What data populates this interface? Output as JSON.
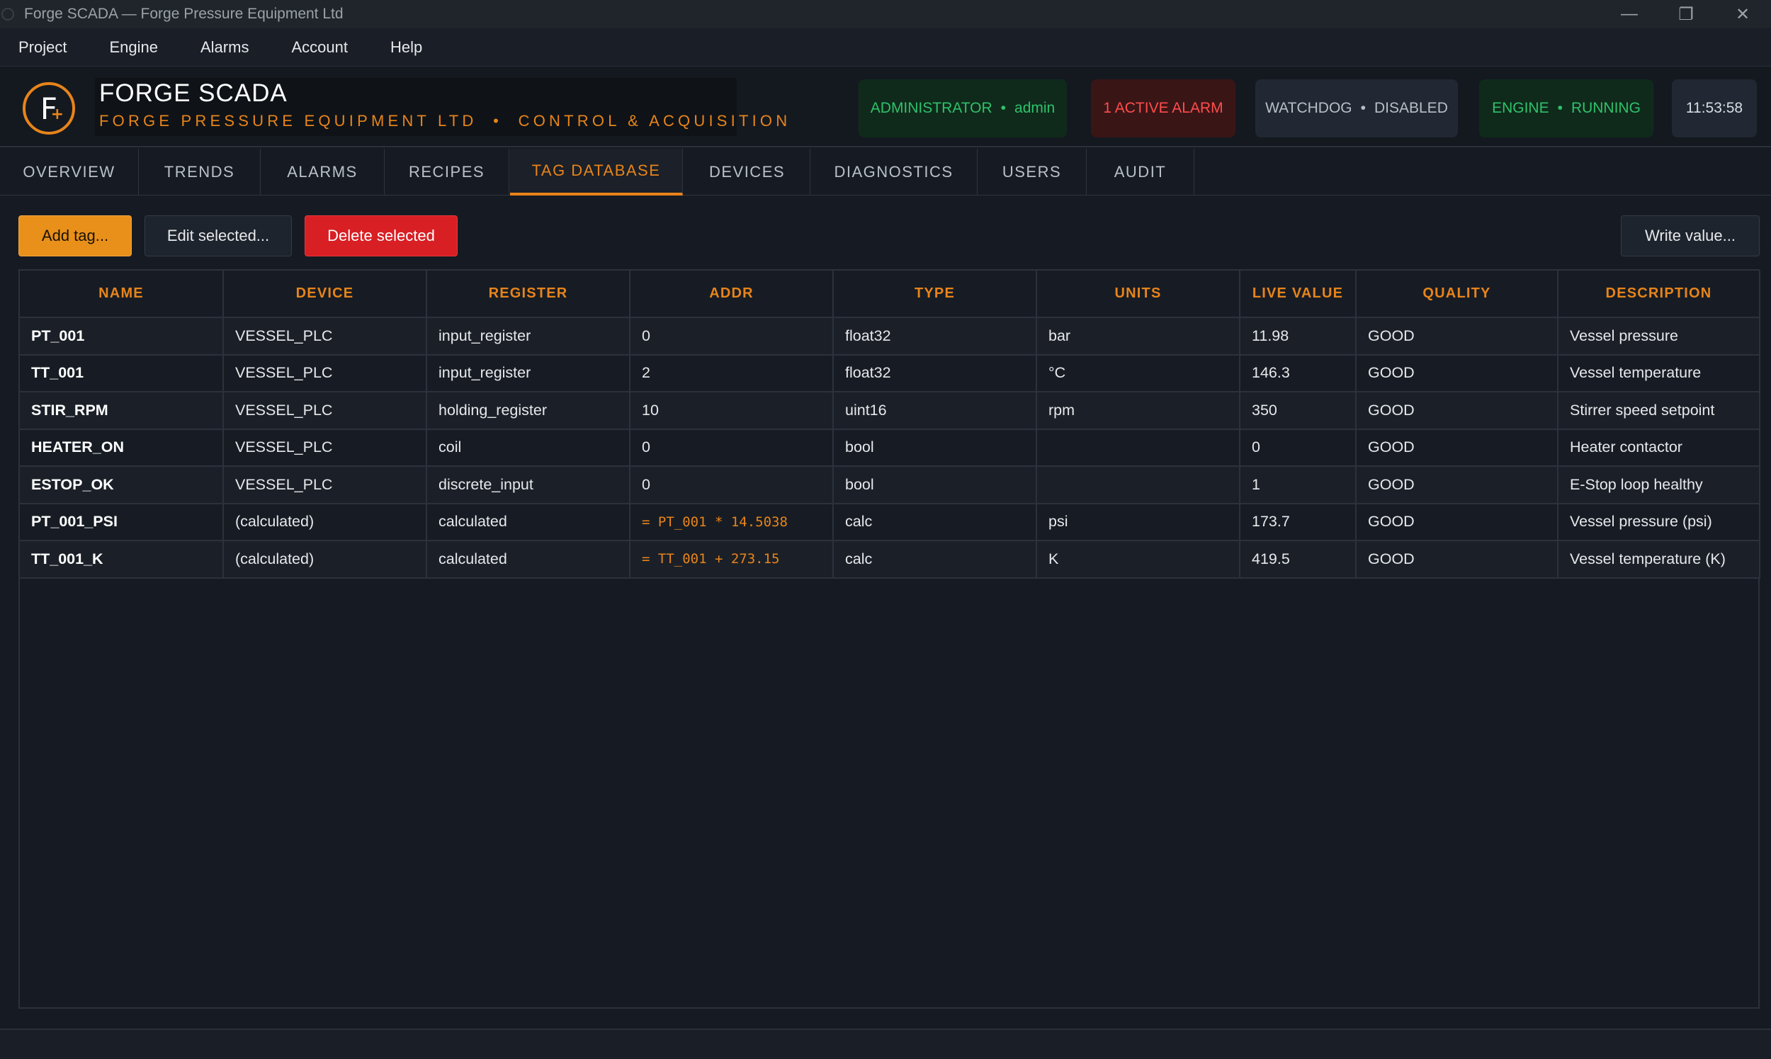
{
  "window": {
    "title": "Forge SCADA — Forge Pressure Equipment Ltd",
    "minimize_glyph": "—",
    "restore_glyph": "❐",
    "close_glyph": "✕"
  },
  "menu": {
    "items": [
      "Project",
      "Engine",
      "Alarms",
      "Account",
      "Help"
    ]
  },
  "header": {
    "logo_letter": "F",
    "logo_plus": "+",
    "title": "FORGE SCADA",
    "subtitle": "FORGE PRESSURE EQUIPMENT LTD  •  CONTROL & ACQUISITION",
    "role_label": "ADMINISTRATOR",
    "user": "admin",
    "dot": "•",
    "alarm_text": "1 ACTIVE ALARM",
    "watchdog_label": "WATCHDOG",
    "watchdog_state": "DISABLED",
    "engine_label": "ENGINE",
    "engine_state": "RUNNING",
    "clock": "11:53:58"
  },
  "tabs": [
    "OVERVIEW",
    "TRENDS",
    "ALARMS",
    "RECIPES",
    "TAG DATABASE",
    "DEVICES",
    "DIAGNOSTICS",
    "USERS",
    "AUDIT"
  ],
  "active_tab": "TAG DATABASE",
  "toolbar": {
    "add_label": "Add tag...",
    "edit_label": "Edit selected...",
    "delete_label": "Delete selected",
    "write_label": "Write value..."
  },
  "table": {
    "columns": [
      "NAME",
      "DEVICE",
      "REGISTER",
      "ADDR",
      "TYPE",
      "UNITS",
      "LIVE VALUE",
      "QUALITY",
      "DESCRIPTION"
    ],
    "rows": [
      [
        "PT_001",
        "VESSEL_PLC",
        "input_register",
        "0",
        "float32",
        "bar",
        "11.98",
        "GOOD",
        "Vessel pressure"
      ],
      [
        "TT_001",
        "VESSEL_PLC",
        "input_register",
        "2",
        "float32",
        "°C",
        "146.3",
        "GOOD",
        "Vessel temperature"
      ],
      [
        "STIR_RPM",
        "VESSEL_PLC",
        "holding_register",
        "10",
        "uint16",
        "rpm",
        "350",
        "GOOD",
        "Stirrer speed setpoint"
      ],
      [
        "HEATER_ON",
        "VESSEL_PLC",
        "coil",
        "0",
        "bool",
        "",
        "0",
        "GOOD",
        "Heater contactor"
      ],
      [
        "ESTOP_OK",
        "VESSEL_PLC",
        "discrete_input",
        "0",
        "bool",
        "",
        "1",
        "GOOD",
        "E-Stop loop healthy"
      ],
      [
        "PT_001_PSI",
        "(calculated)",
        "calculated",
        "= PT_001 * 14.5038",
        "calc",
        "psi",
        "173.7",
        "GOOD",
        "Vessel pressure (psi)"
      ],
      [
        "TT_001_K",
        "(calculated)",
        "calculated",
        "= TT_001 + 273.15",
        "calc",
        "K",
        "419.5",
        "GOOD",
        "Vessel temperature (K)"
      ]
    ]
  },
  "colors": {
    "accent": "#e8841a",
    "ok": "#2fc16a",
    "alarm": "#ff4d4d",
    "danger_button": "#d81f24"
  }
}
